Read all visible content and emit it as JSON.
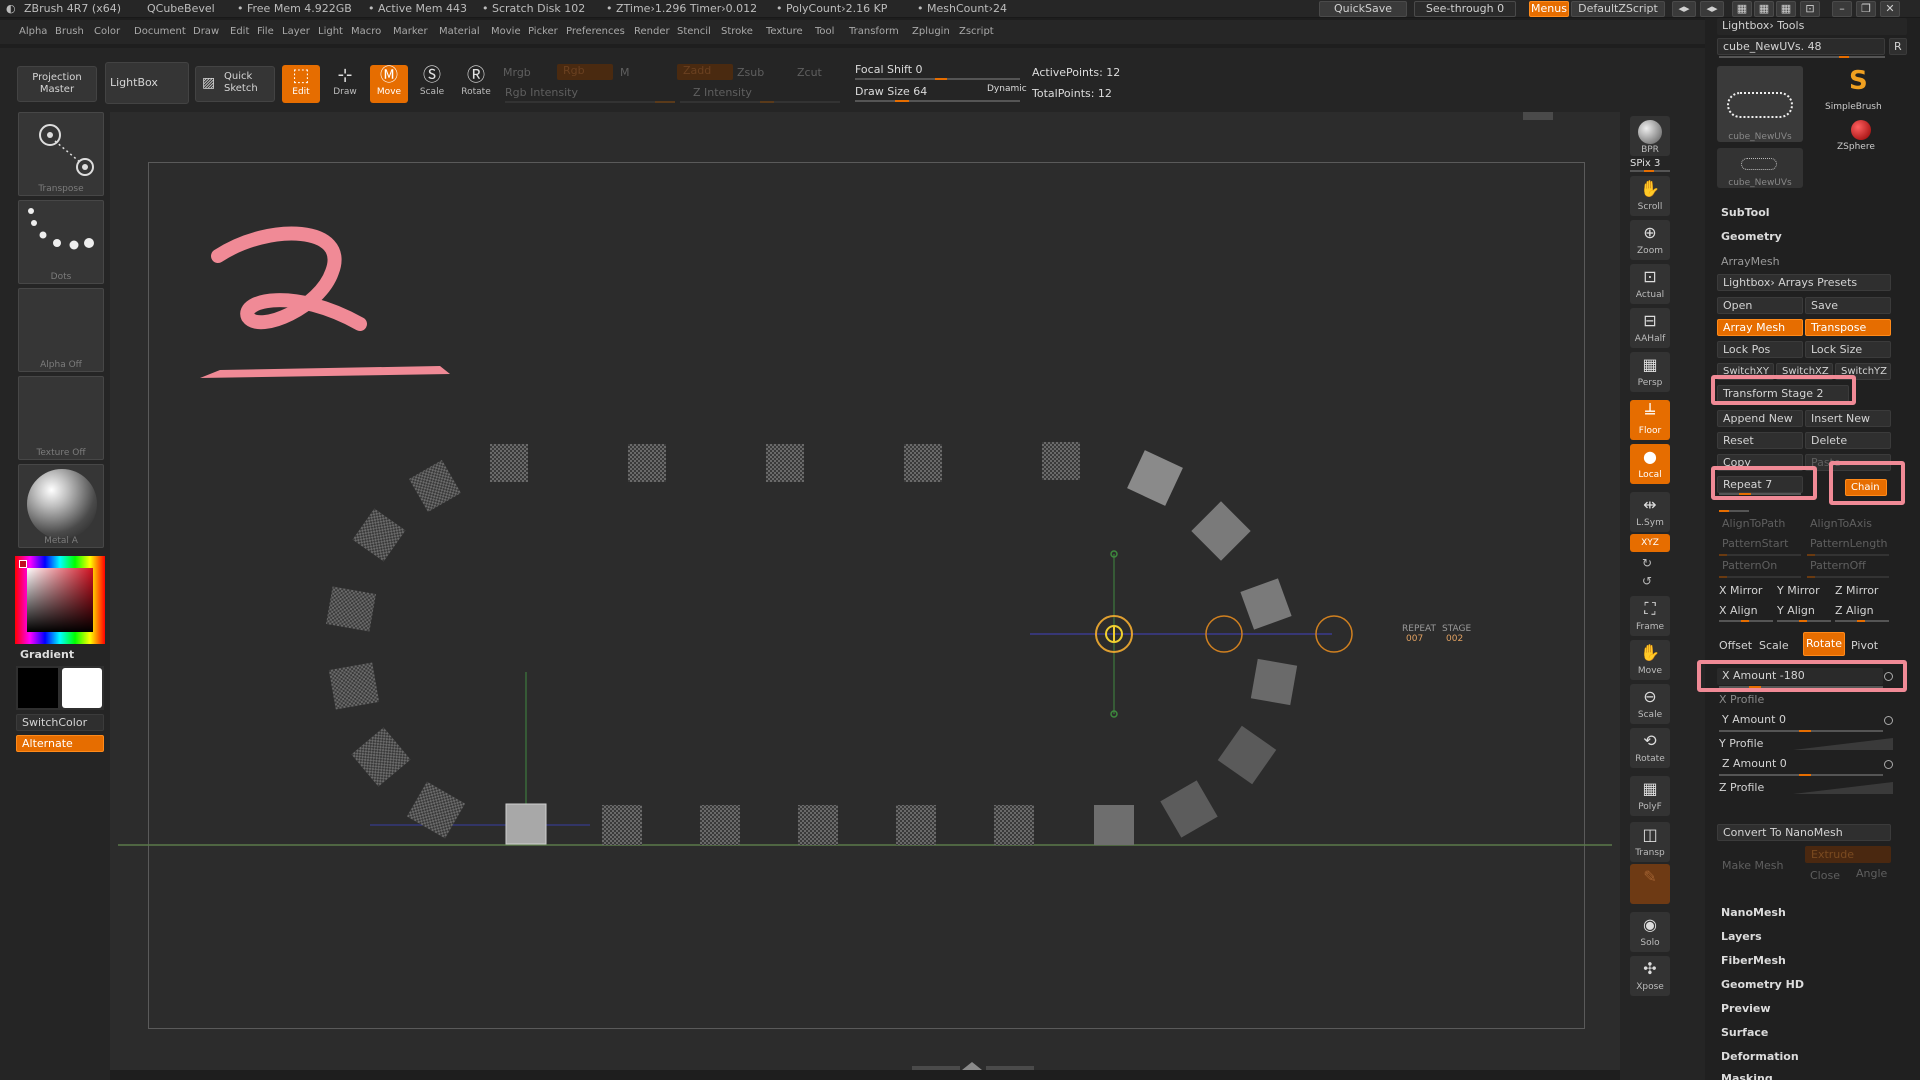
{
  "titlebar": {
    "app": "ZBrush 4R7 (x64)",
    "doc": "QCubeBevel",
    "free_mem": "• Free Mem 4.922GB",
    "active_mem": "• Active Mem 443",
    "scratch": "• Scratch Disk 102",
    "ztime": "• ZTime›1.296 Timer›0.012",
    "polycount": "• PolyCount›2.16 KP",
    "meshcount": "• MeshCount›24",
    "quicksave": "QuickSave",
    "seethrough": "See-through  0",
    "menus": "Menus",
    "script": "DefaultZScript"
  },
  "menu": [
    "Alpha",
    "Brush",
    "Color",
    "Document",
    "Draw",
    "Edit",
    "File",
    "Layer",
    "Light",
    "Macro",
    "Marker",
    "Material",
    "Movie",
    "Picker",
    "Preferences",
    "Render",
    "Stencil",
    "Stroke",
    "Texture",
    "Tool",
    "Transform",
    "Zplugin",
    "Zscript"
  ],
  "toolbar": {
    "projection_master": "Projection\nMaster",
    "lightbox": "LightBox",
    "quick_sketch": "Quick\nSketch",
    "edit": "Edit",
    "draw": "Draw",
    "move": "Move",
    "scale": "Scale",
    "rotate": "Rotate",
    "mrgb": "Mrgb",
    "rgb": "Rgb",
    "m": "M",
    "rgb_intensity": "Rgb Intensity",
    "zadd": "Zadd",
    "zsub": "Zsub",
    "zcut": "Zcut",
    "z_intensity": "Z Intensity",
    "focal_shift": "Focal Shift 0",
    "draw_size": "Draw Size 64",
    "dynamic": "Dynamic",
    "active_points": "ActivePoints: 12",
    "total_points": "TotalPoints: 12"
  },
  "leftshelf": {
    "transpose": "Transpose",
    "dots": "Dots",
    "alpha_off": "Alpha Off",
    "texture_off": "Texture Off",
    "metal": "Metal A",
    "gradient": "Gradient",
    "switchcolor": "SwitchColor",
    "alternate": "Alternate"
  },
  "canvas": {
    "repeat_label": "REPEAT",
    "repeat_value": "007",
    "stage_label": "STAGE",
    "stage_value": "002"
  },
  "rightshelf": [
    "BPR",
    "SPix 3",
    "Scroll",
    "Zoom",
    "Actual",
    "AAHalf",
    "Persp",
    "Floor",
    "Local",
    "L.Sym",
    "XYZ",
    "Frame",
    "Move",
    "Scale",
    "Rotate",
    "PolyF",
    "Transp",
    "Solo",
    "Xpose"
  ],
  "palette": {
    "header": "Lightbox› Tools",
    "tool_name": "cube_NewUVs. 48",
    "r_button": "R",
    "simplebrush": "SimpleBrush",
    "zsphere": "ZSphere",
    "thumb1": "cube_NewUVs",
    "thumb2": "cube_NewUVs",
    "subtool": "SubTool",
    "geometry": "Geometry",
    "arraymesh": "ArrayMesh",
    "presets": "Lightbox› Arrays Presets",
    "open": "Open",
    "save": "Save",
    "array_mesh": "Array Mesh",
    "transpose": "Transpose",
    "lock_pos": "Lock Pos",
    "lock_size": "Lock Size",
    "switchxy": "SwitchXY",
    "switchxz": "SwitchXZ",
    "switchyz": "SwitchYZ",
    "transform_stage": "Transform Stage 2",
    "append_new": "Append New",
    "insert_new": "Insert New",
    "reset": "Reset",
    "delete": "Delete",
    "copy": "Copy",
    "paste": "Paste",
    "repeat": "Repeat 7",
    "chain": "Chain",
    "aligntopath": "AlignToPath",
    "aligntoaxis": "AlignToAxis",
    "patternstart": "PatternStart",
    "patternlength": "PatternLength",
    "patternon": "PatternOn",
    "patternoff": "PatternOff",
    "x_mirror": "X Mirror",
    "y_mirror": "Y Mirror",
    "z_mirror": "Z Mirror",
    "x_align": "X Align",
    "y_align": "Y Align",
    "z_align": "Z Align",
    "offset": "Offset",
    "scale": "Scale",
    "rotate": "Rotate",
    "pivot": "Pivot",
    "x_amount": "X Amount -180",
    "x_profile": "X Profile",
    "y_amount": "Y Amount 0",
    "y_profile": "Y Profile",
    "z_amount": "Z Amount 0",
    "z_profile": "Z Profile",
    "convert_nanomesh": "Convert To NanoMesh",
    "extrude": "Extrude",
    "make_mesh": "Make Mesh",
    "close": "Close",
    "angle": "Angle",
    "sections": [
      "NanoMesh",
      "Layers",
      "FiberMesh",
      "Geometry HD",
      "Preview",
      "Surface",
      "Deformation",
      "Masking"
    ]
  }
}
